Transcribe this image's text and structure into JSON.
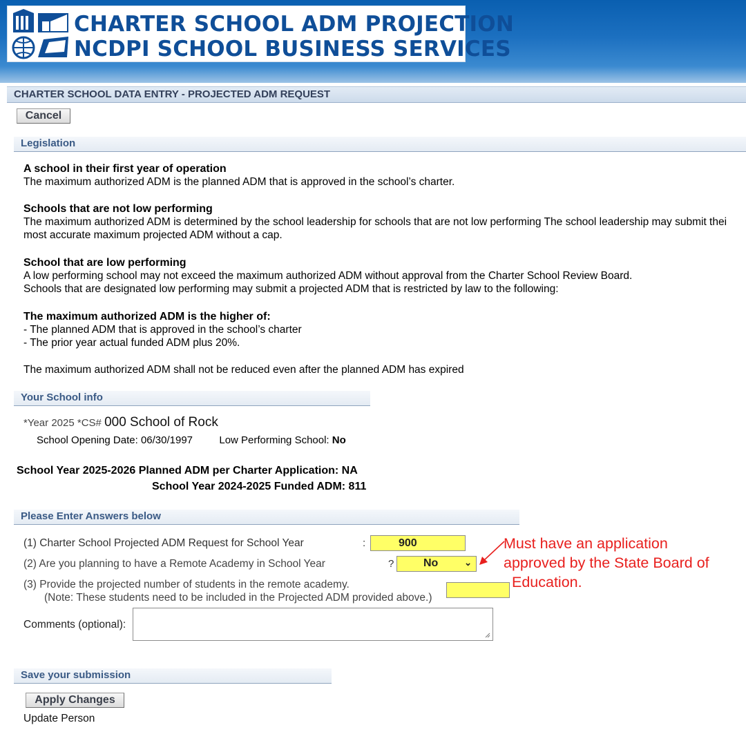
{
  "banner": {
    "title_line1": "CHARTER SCHOOL ADM PROJECTION",
    "title_line2": "NCDPI SCHOOL BUSINESS SERVICES"
  },
  "page_header": "CHARTER SCHOOL DATA ENTRY - PROJECTED ADM REQUEST",
  "buttons": {
    "cancel": "Cancel",
    "apply": "Apply Changes"
  },
  "legislation": {
    "heading": "Legislation",
    "first_year_title": "A school in their first year of operation",
    "first_year_text": "The maximum authorized ADM is the planned ADM that is approved in the school’s charter.",
    "not_low_title": "Schools that are not low performing",
    "not_low_text1": "The maximum authorized ADM is determined by the school leadership for schools that are not low performing The school leadership may submit thei",
    "not_low_text2": "most accurate maximum projected ADM without a cap.",
    "low_title": "School that are low performing",
    "low_text1": "A low performing school may not exceed the maximum authorized ADM without approval from the Charter School Review Board.",
    "low_text2": "Schools that are designated low performing may submit a projected ADM that is restricted by law to the following:",
    "higher_title": "The maximum authorized ADM is the higher of:",
    "higher_item1": "- The planned ADM that is approved in the school’s charter",
    "higher_item2": "- The prior year actual funded ADM plus 20%.",
    "closing": "The maximum authorized ADM shall not be reduced even after the planned ADM has expired"
  },
  "school_info": {
    "heading": "Your School info",
    "year_label": "*Year",
    "year": "2025",
    "cs_label": "*CS#",
    "school": "000 School of Rock",
    "opening_label": "School Opening Date:",
    "opening_date": "06/30/1997",
    "low_perf_label": "Low Performing School:",
    "low_perf_value": "No",
    "planned_label": "School Year 2025-2026 Planned ADM per Charter Application:",
    "planned_value": "NA",
    "funded_label": "School Year 2024-2025 Funded ADM:",
    "funded_value": "811"
  },
  "answers": {
    "heading": "Please Enter Answers below",
    "q1": "(1) Charter School Projected ADM Request for School Year",
    "q1_punct": ":",
    "q1_value": "900",
    "q2": "(2) Are you planning to have a Remote Academy in School Year",
    "q2_punct": "?",
    "q2_value": "No",
    "q3_line1": "(3) Provide the projected number of students in the remote academy.",
    "q3_line2": "(Note: These students need to be included in the Projected ADM provided above.)",
    "q3_value": "",
    "comments_label": "Comments (optional):",
    "comments_value": ""
  },
  "annotation": {
    "line1": "Must have an application",
    "line2": "approved by the State Board of",
    "line3": "Education."
  },
  "save": {
    "heading": "Save your submission",
    "update_person": "Update Person"
  },
  "colors": {
    "annotation_red": "#e8201e",
    "input_yellow": "#ffff66",
    "banner_blue": "#0f4e98"
  },
  "icons": [
    "building-icon",
    "globe-icon"
  ]
}
